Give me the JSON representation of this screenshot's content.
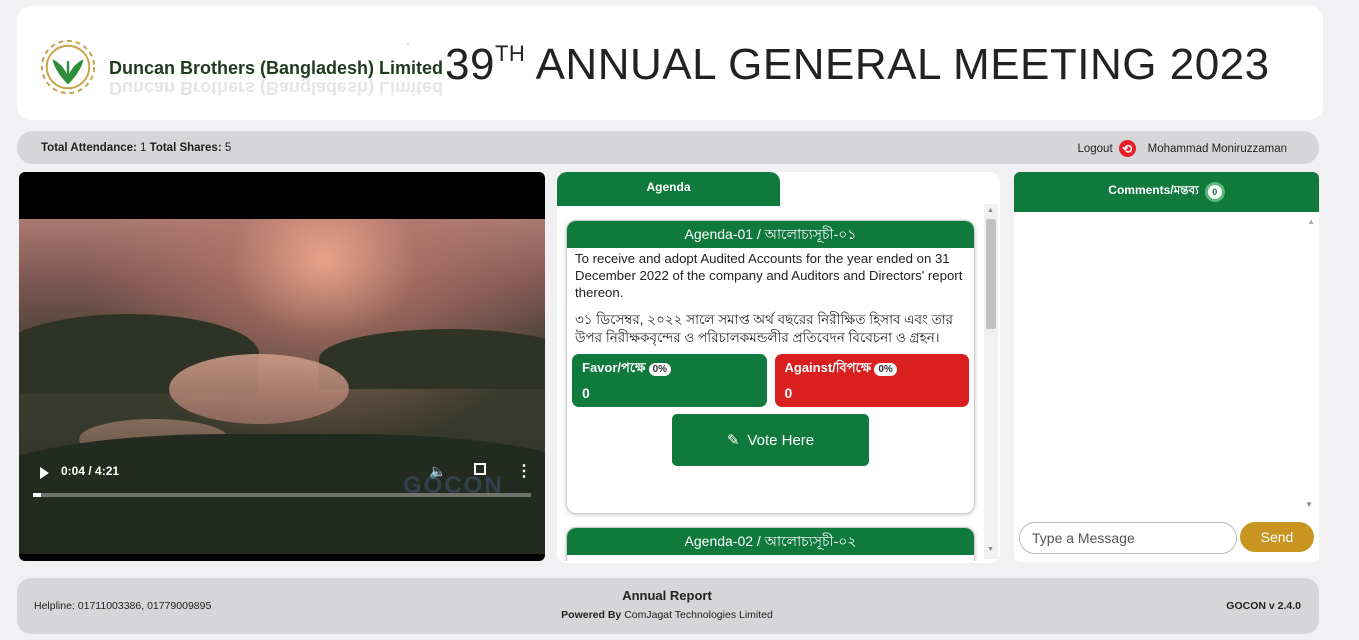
{
  "header": {
    "company": "Duncan Brothers (Bangladesh) Limited",
    "title_prefix": "39",
    "title_sup": "TH",
    "title_rest": " ANNUAL GENERAL MEETING 2023"
  },
  "status": {
    "attendance_label": "Total Attendance:",
    "attendance_value": "1",
    "shares_label": "Total Shares:",
    "shares_value": "5",
    "logout_label": "Logout",
    "user_name": "Mohammad Moniruzzaman"
  },
  "video": {
    "time": "0:04 / 4:21",
    "progress": 0.016,
    "watermark": "GOCON"
  },
  "agenda": {
    "tab_label": "Agenda",
    "items": [
      {
        "title": "Agenda-01 / আলোচ্যসূচী-০১",
        "text_en": "To receive and adopt Audited Accounts for the year ended on 31 December 2022 of the company and Auditors and Directors' report thereon.",
        "text_bn": "৩১ ডিসেম্বর, ২০২২ সালে সমাপ্ত অর্থ বছরের নিরীক্ষিত হিসাব এবং তার উপর নিরীক্ষকবৃন্দের ও পরিচালকমন্ডলীর প্রতিবেদন বিবেচনা ও গ্রহন।",
        "favor_label": "Favor/পক্ষে",
        "favor_pct": "0%",
        "favor_count": "0",
        "against_label": "Against/বিপক্ষে",
        "against_pct": "0%",
        "against_count": "0",
        "vote_label": "Vote Here"
      },
      {
        "title": "Agenda-02 / আলোচ্যসূচী-০২"
      }
    ]
  },
  "comments": {
    "title": "Comments/মন্তব্য",
    "count": "0",
    "input_placeholder": "Type a Message",
    "send_label": "Send"
  },
  "footer": {
    "helpline": "Helpline: 01711003386, 01779009895",
    "annual_report": "Annual Report",
    "powered_by_label": "Powered By",
    "powered_by_company": "ComJagat Technologies Limited",
    "version": "GOCON v 2.4.0"
  },
  "colors": {
    "primary_green": "#0f7a3c",
    "against_red": "#da1f1f",
    "send_gold": "#c89520",
    "logout_red": "#e81f26"
  }
}
